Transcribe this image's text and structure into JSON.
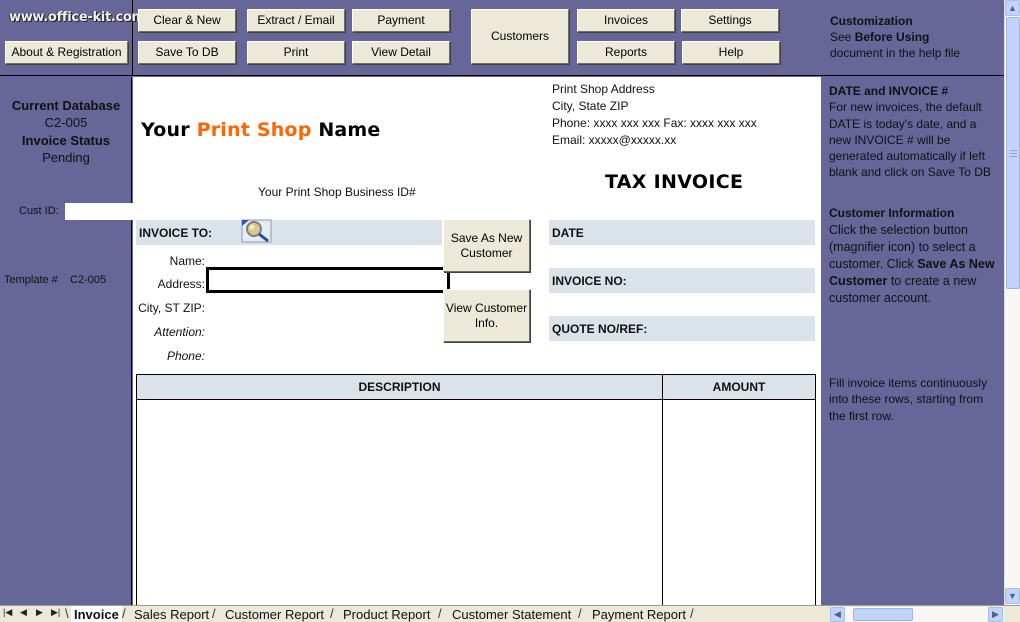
{
  "toolbar": {
    "logo": "www.office-kit.com",
    "about_label": "About & Registration",
    "clear_new": "Clear & New",
    "extract_email": "Extract / Email",
    "payment": "Payment",
    "save_to_db": "Save To DB",
    "print": "Print",
    "view_detail": "View Detail",
    "customers": "Customers",
    "invoices": "Invoices",
    "settings": "Settings",
    "reports": "Reports",
    "help": "Help",
    "help_title": "Customization",
    "help_line2_pre": "See ",
    "help_line2_bold": "Before Using",
    "help_line3": "document in the help file"
  },
  "left_panel": {
    "current_db_label": "Current Database",
    "current_db_value": "C2-005",
    "invoice_status_label": "Invoice Status",
    "invoice_status_value": "Pending",
    "cust_id_label": "Cust ID:",
    "cust_id_value": "",
    "template_label": "Template #",
    "template_value": "C2-005"
  },
  "invoice": {
    "shop_name_pre": "Your ",
    "shop_name_accent": "Print Shop",
    "shop_name_post": " Name",
    "business_id": "Your Print Shop Business ID#",
    "address_lines": [
      "Print Shop Address",
      "City, State ZIP",
      "Phone: xxxx xxx xxx Fax: xxxx xxx xxx",
      "Email: xxxxx@xxxxx.xx"
    ],
    "title": "TAX INVOICE",
    "invoice_to_label": "INVOICE TO:",
    "fields": {
      "name": "Name:",
      "address": "Address:",
      "city": "City, ST ZIP:",
      "attention": "Attention:",
      "phone": "Phone:"
    },
    "address_value": "",
    "save_new_customer": "Save As New Customer",
    "view_customer_info": "View Customer Info.",
    "date_label": "DATE",
    "invoice_no_label": "INVOICE NO:",
    "quote_no_label": "QUOTE NO/REF:",
    "table": {
      "columns": [
        "DESCRIPTION",
        "AMOUNT"
      ],
      "rows": []
    }
  },
  "right_panel": {
    "date_title": "DATE and INVOICE #",
    "date_text": "For new invoices, the default DATE is today's date, and a new INVOICE # will be generated automatically if left blank and click on Save To DB",
    "cust_title": "Customer Information",
    "cust_text_pre": "Click the selection button (magnifier icon) to select a customer. Click ",
    "cust_text_bold": "Save As New Customer",
    "cust_text_post": " to create a new customer account.",
    "fill_text": "Fill invoice items continuously into these rows, starting from the first row."
  },
  "sheet_tabs": {
    "tabs": [
      "Invoice",
      "Sales Report",
      "Customer Report",
      "Product Report",
      "Customer Statement",
      "Payment Report"
    ],
    "active": "Invoice"
  },
  "colors": {
    "panel": "#666699",
    "accent": "#ff6600",
    "band": "#dae3e9",
    "button": "#ece9d8"
  }
}
